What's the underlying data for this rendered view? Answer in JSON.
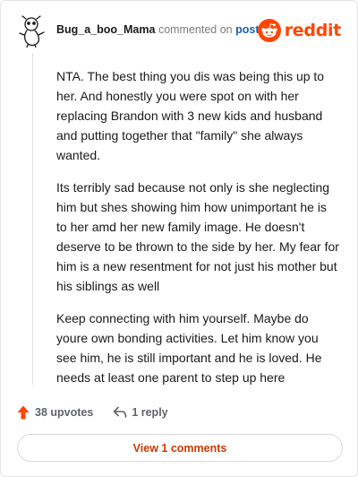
{
  "header": {
    "author": "Bug_a_boo_Mama",
    "action": "commented on",
    "post_link": "post",
    "brand_name": "reddit"
  },
  "comment": {
    "paragraphs": [
      "NTA. The best thing you dis was being this up to her. And honestly you were spot on with her replacing Brandon with 3 new kids and husband and putting together that \"family\" she always wanted.",
      "Its terribly sad because not only is she neglecting him but shes showing him how unimportant he is to her amd her new family image. He doesn't deserve to be thrown to the side by her. My fear for him is a new resentment for not just his mother but his siblings as well",
      "Keep connecting with him yourself. Maybe do youre own bonding activities. Let him know you see him, he is still important and he is loved. He needs at least one parent to step up here"
    ]
  },
  "footer": {
    "upvotes": "38 upvotes",
    "replies": "1 reply"
  },
  "view_comments_label": "View 1 comments",
  "colors": {
    "brand": "#ff4500",
    "link": "#1f5fae",
    "muted": "#5f6368"
  },
  "icons": [
    "avatar-doodle-icon",
    "reddit-snoo-icon",
    "upvote-arrow-icon",
    "reply-arrow-icon"
  ]
}
